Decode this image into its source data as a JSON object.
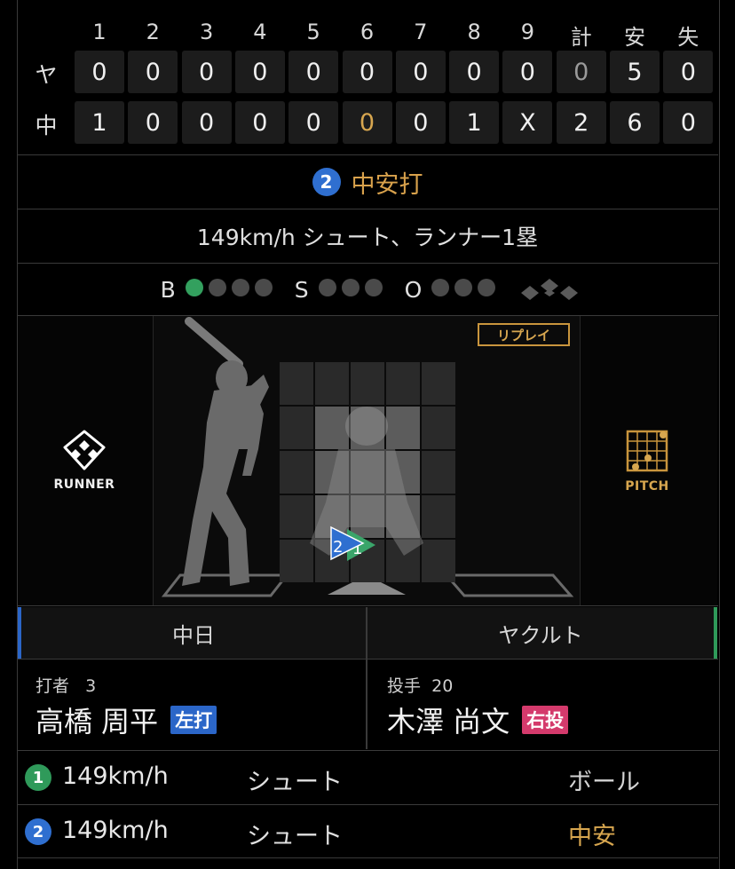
{
  "scoreboard": {
    "innings": [
      "1",
      "2",
      "3",
      "4",
      "5",
      "6",
      "7",
      "8",
      "9"
    ],
    "totals_headers": [
      "計",
      "安",
      "失"
    ],
    "rows": [
      {
        "team": "ヤ",
        "scores": [
          "0",
          "0",
          "0",
          "0",
          "0",
          "0",
          "0",
          "0",
          "0"
        ],
        "totals": [
          "0",
          "5",
          "0"
        ]
      },
      {
        "team": "中",
        "scores": [
          "1",
          "0",
          "0",
          "0",
          "0",
          "0",
          "0",
          "1",
          "X"
        ],
        "totals": [
          "2",
          "6",
          "0"
        ]
      }
    ]
  },
  "play": {
    "number": "2",
    "result": "中安打"
  },
  "description": "149km/h シュート、ランナー1塁",
  "count": {
    "ball_label": "B",
    "strike_label": "S",
    "out_label": "O",
    "balls": 1,
    "strikes": 0,
    "outs": 0
  },
  "field": {
    "replay_label": "リプレイ",
    "runner_label": "RUNNER",
    "pitch_label": "PITCH",
    "pitch_markers": [
      "2",
      "1"
    ]
  },
  "teams": {
    "home": {
      "name": "中日",
      "role": "打者",
      "number": "3",
      "player": "高橋 周平",
      "hand": "左打"
    },
    "away": {
      "name": "ヤクルト",
      "role": "投手",
      "number": "20",
      "player": "木澤 尚文",
      "hand": "右投"
    }
  },
  "pitches": [
    {
      "no": "1",
      "speed": "149km/h",
      "type": "シュート",
      "result": "ボール"
    },
    {
      "no": "2",
      "speed": "149km/h",
      "type": "シュート",
      "result": "中安"
    }
  ],
  "colors": {
    "accent": "#d7a64f",
    "ball_dot": "#33a05e",
    "pitch1": "#2f9a5a",
    "pitch2": "#2f6fd0"
  },
  "icons": {
    "runner": "baseball-diamond-icon",
    "pitch": "strike-zone-grid-icon"
  }
}
